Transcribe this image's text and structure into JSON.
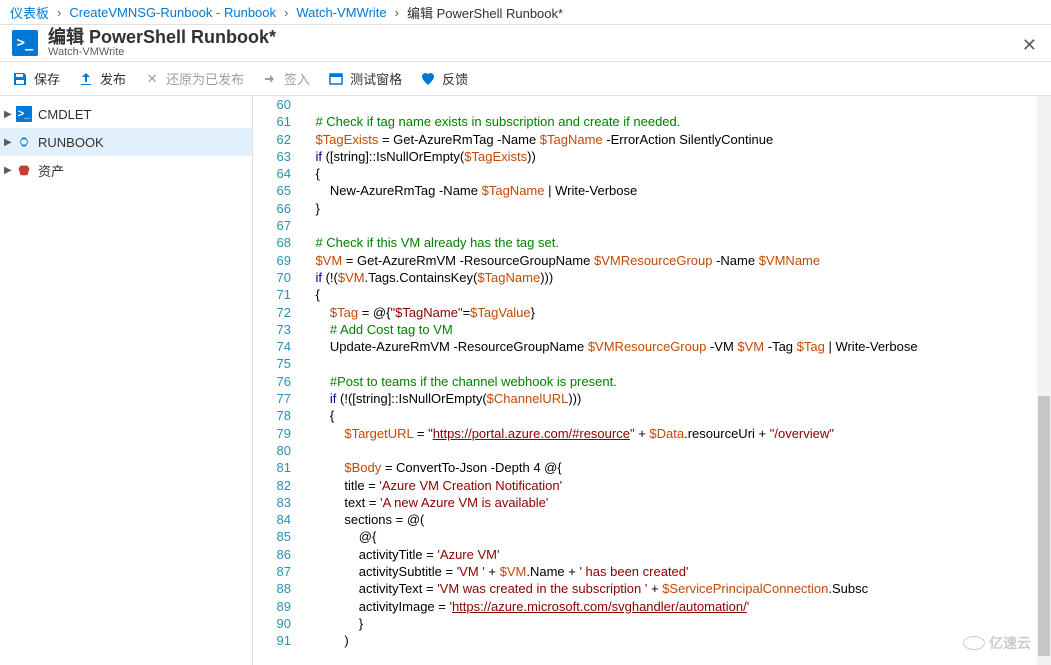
{
  "breadcrumb": {
    "items": [
      "仪表板",
      "CreateVMNSG-Runbook - Runbook",
      "Watch-VMWrite"
    ],
    "current": "编辑 PowerShell Runbook*"
  },
  "header": {
    "logo_text": ">_",
    "title": "编辑 PowerShell Runbook*",
    "subtitle": "Watch-VMWrite"
  },
  "toolbar": {
    "save": "保存",
    "publish": "发布",
    "revert": "还原为已发布",
    "checkin": "签入",
    "testpane": "测试窗格",
    "feedback": "反馈"
  },
  "sidebar": {
    "items": [
      {
        "label": "CMDLET",
        "icon": "cmdlet"
      },
      {
        "label": "RUNBOOK",
        "icon": "runbook"
      },
      {
        "label": "资产",
        "icon": "asset"
      }
    ]
  },
  "editor": {
    "startLine": 60,
    "lines": [
      {
        "n": 60,
        "t": [
          [
            "",
            ""
          ]
        ]
      },
      {
        "n": 61,
        "t": [
          [
            "    ",
            "p"
          ],
          [
            "# Check if tag name exists in subscription and create if needed.",
            "comment"
          ]
        ]
      },
      {
        "n": 62,
        "t": [
          [
            "    ",
            "p"
          ],
          [
            "$TagExists",
            "var"
          ],
          [
            " = Get-AzureRmTag -Name ",
            "p"
          ],
          [
            "$TagName",
            "var"
          ],
          [
            " -ErrorAction SilentlyContinue",
            "p"
          ]
        ]
      },
      {
        "n": 63,
        "t": [
          [
            "    ",
            "p"
          ],
          [
            "if",
            "kw"
          ],
          [
            " ([string]::IsNullOrEmpty(",
            "p"
          ],
          [
            "$TagExists",
            "var"
          ],
          [
            "))",
            "p"
          ]
        ]
      },
      {
        "n": 64,
        "t": [
          [
            "    {",
            "p"
          ]
        ]
      },
      {
        "n": 65,
        "t": [
          [
            "        New-AzureRmTag -Name ",
            "p"
          ],
          [
            "$TagName",
            "var"
          ],
          [
            " | Write-Verbose",
            "p"
          ]
        ]
      },
      {
        "n": 66,
        "t": [
          [
            "    }",
            "p"
          ]
        ]
      },
      {
        "n": 67,
        "t": [
          [
            "",
            ""
          ]
        ]
      },
      {
        "n": 68,
        "t": [
          [
            "    ",
            "p"
          ],
          [
            "# Check if this VM already has the tag set.",
            "comment"
          ]
        ]
      },
      {
        "n": 69,
        "t": [
          [
            "    ",
            "p"
          ],
          [
            "$VM",
            "var"
          ],
          [
            " = Get-AzureRmVM -ResourceGroupName ",
            "p"
          ],
          [
            "$VMResourceGroup",
            "var"
          ],
          [
            " -Name ",
            "p"
          ],
          [
            "$VMName",
            "var"
          ]
        ]
      },
      {
        "n": 70,
        "t": [
          [
            "    ",
            "p"
          ],
          [
            "if",
            "kw"
          ],
          [
            " (!(",
            "p"
          ],
          [
            "$VM",
            "var"
          ],
          [
            ".Tags.ContainsKey(",
            "p"
          ],
          [
            "$TagName",
            "var"
          ],
          [
            ")))",
            "p"
          ]
        ]
      },
      {
        "n": 71,
        "t": [
          [
            "    {",
            "p"
          ]
        ]
      },
      {
        "n": 72,
        "t": [
          [
            "        ",
            "p"
          ],
          [
            "$Tag",
            "var"
          ],
          [
            " = @{",
            "p"
          ],
          [
            "\"$TagName\"",
            "str"
          ],
          [
            "=",
            "p"
          ],
          [
            "$TagValue",
            "var"
          ],
          [
            "}",
            "p"
          ]
        ]
      },
      {
        "n": 73,
        "t": [
          [
            "        ",
            "p"
          ],
          [
            "# Add Cost tag to VM",
            "comment"
          ]
        ]
      },
      {
        "n": 74,
        "t": [
          [
            "        Update-AzureRmVM -ResourceGroupName ",
            "p"
          ],
          [
            "$VMResourceGroup",
            "var"
          ],
          [
            " -VM ",
            "p"
          ],
          [
            "$VM",
            "var"
          ],
          [
            " -Tag ",
            "p"
          ],
          [
            "$Tag",
            "var"
          ],
          [
            " | Write-Verbose",
            "p"
          ]
        ]
      },
      {
        "n": 75,
        "t": [
          [
            "",
            ""
          ]
        ]
      },
      {
        "n": 76,
        "t": [
          [
            "        ",
            "p"
          ],
          [
            "#Post to teams if the channel webhook is present.",
            "comment"
          ]
        ]
      },
      {
        "n": 77,
        "t": [
          [
            "        ",
            "p"
          ],
          [
            "if",
            "kw"
          ],
          [
            " (!([string]::IsNullOrEmpty(",
            "p"
          ],
          [
            "$ChannelURL",
            "var"
          ],
          [
            ")))",
            "p"
          ]
        ]
      },
      {
        "n": 78,
        "t": [
          [
            "        {",
            "p"
          ]
        ]
      },
      {
        "n": 79,
        "t": [
          [
            "            ",
            "p"
          ],
          [
            "$TargetURL",
            "var"
          ],
          [
            " = ",
            "p"
          ],
          [
            "\"",
            "str"
          ],
          [
            "https://portal.azure.com/#resource",
            "strlink"
          ],
          [
            "\"",
            "str"
          ],
          [
            " + ",
            "p"
          ],
          [
            "$Data",
            "var"
          ],
          [
            ".resourceUri + ",
            "p"
          ],
          [
            "\"/overview\"",
            "str"
          ]
        ]
      },
      {
        "n": 80,
        "t": [
          [
            "",
            ""
          ]
        ]
      },
      {
        "n": 81,
        "t": [
          [
            "            ",
            "p"
          ],
          [
            "$Body",
            "var"
          ],
          [
            " = ConvertTo-Json -Depth ",
            "p"
          ],
          [
            "4",
            "num"
          ],
          [
            " @{",
            "p"
          ]
        ]
      },
      {
        "n": 82,
        "t": [
          [
            "            title = ",
            "p"
          ],
          [
            "'Azure VM Creation Notification'",
            "str"
          ]
        ]
      },
      {
        "n": 83,
        "t": [
          [
            "            text = ",
            "p"
          ],
          [
            "'A new Azure VM is available'",
            "str"
          ]
        ]
      },
      {
        "n": 84,
        "t": [
          [
            "            sections = @(",
            "p"
          ]
        ]
      },
      {
        "n": 85,
        "t": [
          [
            "                @{",
            "p"
          ]
        ]
      },
      {
        "n": 86,
        "t": [
          [
            "                activityTitle = ",
            "p"
          ],
          [
            "'Azure VM'",
            "str"
          ]
        ]
      },
      {
        "n": 87,
        "t": [
          [
            "                activitySubtitle = ",
            "p"
          ],
          [
            "'VM '",
            "str"
          ],
          [
            " + ",
            "p"
          ],
          [
            "$VM",
            "var"
          ],
          [
            ".Name + ",
            "p"
          ],
          [
            "' has been created'",
            "str"
          ]
        ]
      },
      {
        "n": 88,
        "t": [
          [
            "                activityText = ",
            "p"
          ],
          [
            "'VM was created in the subscription '",
            "str"
          ],
          [
            " + ",
            "p"
          ],
          [
            "$ServicePrincipalConnection",
            "var"
          ],
          [
            ".Subsc",
            "p"
          ]
        ]
      },
      {
        "n": 89,
        "t": [
          [
            "                activityImage = ",
            "p"
          ],
          [
            "'",
            "str"
          ],
          [
            "https://azure.microsoft.com/svghandler/automation/",
            "strlink"
          ],
          [
            "'",
            "str"
          ]
        ]
      },
      {
        "n": 90,
        "t": [
          [
            "                }",
            "p"
          ]
        ]
      },
      {
        "n": 91,
        "t": [
          [
            "            )",
            "p"
          ]
        ]
      }
    ]
  },
  "watermark": "亿速云"
}
